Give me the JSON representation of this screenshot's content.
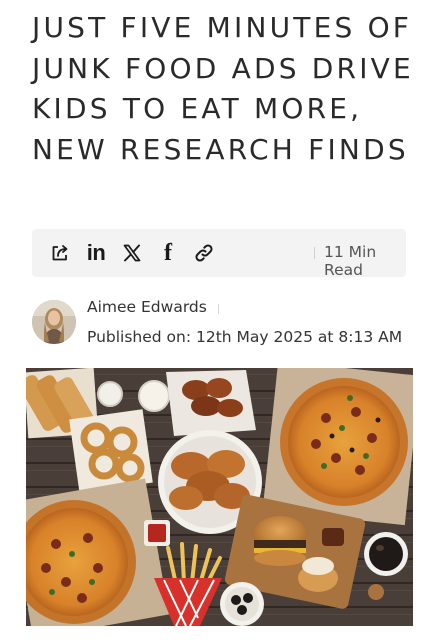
{
  "article": {
    "headline": "JUST FIVE MINUTES OF JUNK FOOD ADS DRIVE KIDS TO EAT MORE, NEW RESEARCH FINDS"
  },
  "share_bar": {
    "icons": [
      "share-icon",
      "linkedin-icon",
      "x-icon",
      "facebook-icon",
      "link-icon"
    ],
    "linkedin_glyph": "in",
    "facebook_glyph": "f",
    "read_time": "11 Min Read"
  },
  "author": {
    "name": "Aimee Edwards",
    "published": "Published on: 12th May 2025 at 8:13 AM"
  },
  "hero_image": {
    "subject": "junk-food-spread"
  },
  "colors": {
    "headline": "#2a2a2a",
    "share_bar_bg": "#f3f3f3",
    "body_text": "#333333",
    "muted_text": "#555555"
  }
}
